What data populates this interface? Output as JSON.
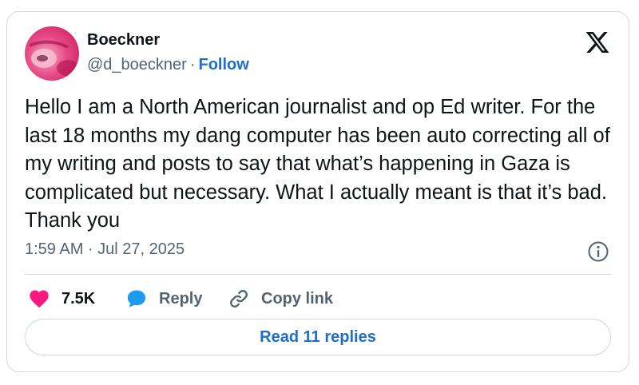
{
  "author": {
    "name": "Boeckner",
    "handle": "@d_boeckner",
    "separator": "·",
    "follow_label": "Follow"
  },
  "tweet": {
    "text": "Hello I am a North American journalist and op Ed writer. For the last 18 months my dang computer has been auto correcting all of my writing and posts to say that what’s happening in Gaza is complicated but necessary. What I actually meant is that it’s bad. Thank you",
    "timestamp": "1:59 AM · Jul 27, 2025"
  },
  "actions": {
    "like_count": "7.5K",
    "reply_label": "Reply",
    "copy_link_label": "Copy link"
  },
  "read_replies_label": "Read 11 replies",
  "icons": {
    "brand": "x-logo-icon",
    "info": "info-icon",
    "like": "heart-icon",
    "reply": "speech-bubble-icon",
    "copy": "link-icon"
  },
  "colors": {
    "like": "#f91880",
    "reply": "#1d9bf0",
    "link": "#1d70c4",
    "muted": "#536471",
    "border": "#cfd9de",
    "text": "#0f1419"
  }
}
